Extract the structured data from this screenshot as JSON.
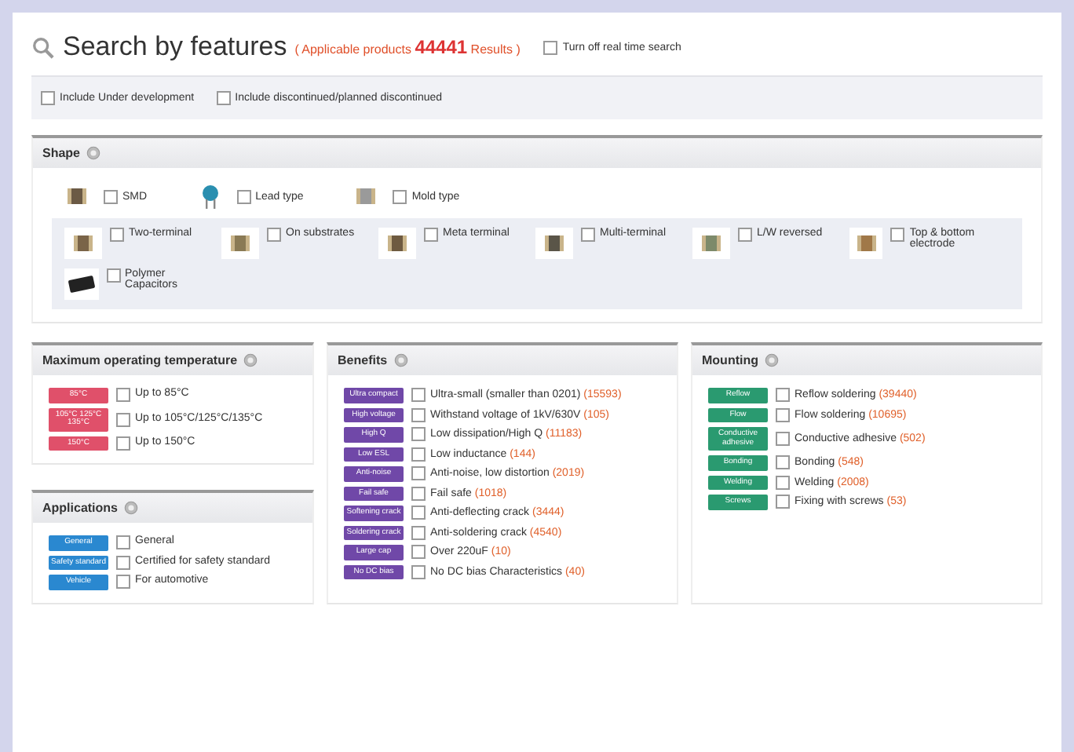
{
  "header": {
    "title": "Search by features",
    "results_prefix": "( Applicable products",
    "results_count": "44441",
    "results_suffix": "Results )",
    "realtime": {
      "label": "Turn off real time search",
      "checked": false
    }
  },
  "filters": [
    {
      "label": "Include Under development",
      "checked": false
    },
    {
      "label": "Include discontinued/planned discontinued",
      "checked": false
    }
  ],
  "shape": {
    "title": "Shape",
    "types": [
      {
        "label": "SMD",
        "checked": false
      },
      {
        "label": "Lead type",
        "checked": false
      },
      {
        "label": "Mold type",
        "checked": false
      }
    ],
    "subtypes": [
      {
        "label": "Two-terminal",
        "checked": false
      },
      {
        "label": "On substrates",
        "checked": false
      },
      {
        "label": "Meta terminal",
        "checked": false
      },
      {
        "label": "Multi-terminal",
        "checked": false
      },
      {
        "label": "L/W reversed",
        "checked": false
      },
      {
        "label": "Top & bottom electrode",
        "checked": false
      },
      {
        "label": "Polymer Capacitors",
        "checked": false
      }
    ]
  },
  "temperature": {
    "title": "Maximum operating temperature",
    "items": [
      {
        "badge": "85°C",
        "label": "Up to 85°C",
        "checked": false
      },
      {
        "badge": "105°C 125°C 135°C",
        "label": "Up to 105°C/125°C/135°C",
        "checked": false
      },
      {
        "badge": "150°C",
        "label": "Up to 150°C",
        "checked": false
      }
    ]
  },
  "applications": {
    "title": "Applications",
    "items": [
      {
        "badge": "General",
        "label": "General",
        "checked": false
      },
      {
        "badge": "Safety standard",
        "label": "Certified for safety standard",
        "checked": false
      },
      {
        "badge": "Vehicle",
        "label": "For automotive",
        "checked": false
      }
    ]
  },
  "benefits": {
    "title": "Benefits",
    "items": [
      {
        "badge": "Ultra compact",
        "label": "Ultra-small (smaller than 0201)",
        "count": "(15593)",
        "checked": false
      },
      {
        "badge": "High voltage",
        "label": "Withstand voltage of 1kV/630V",
        "count": "(105)",
        "checked": false
      },
      {
        "badge": "High Q",
        "label": "Low dissipation/High Q",
        "count": "(11183)",
        "checked": false
      },
      {
        "badge": "Low ESL",
        "label": "Low inductance",
        "count": "(144)",
        "checked": false
      },
      {
        "badge": "Anti-noise",
        "label": "Anti-noise, low distortion",
        "count": "(2019)",
        "checked": false
      },
      {
        "badge": "Fail safe",
        "label": "Fail safe",
        "count": "(1018)",
        "checked": false
      },
      {
        "badge": "Softening crack",
        "label": "Anti-deflecting crack",
        "count": "(3444)",
        "checked": false
      },
      {
        "badge": "Soldering crack",
        "label": "Anti-soldering crack",
        "count": "(4540)",
        "checked": false
      },
      {
        "badge": "Large cap",
        "label": "Over 220uF",
        "count": "(10)",
        "checked": false
      },
      {
        "badge": "No DC bias",
        "label": "No DC bias Characteristics",
        "count": "(40)",
        "checked": false
      }
    ]
  },
  "mounting": {
    "title": "Mounting",
    "items": [
      {
        "badge": "Reflow",
        "label": "Reflow soldering",
        "count": "(39440)",
        "checked": false
      },
      {
        "badge": "Flow",
        "label": "Flow soldering",
        "count": "(10695)",
        "checked": false
      },
      {
        "badge": "Conductive adhesive",
        "label": "Conductive adhesive",
        "count": "(502)",
        "checked": false
      },
      {
        "badge": "Bonding",
        "label": "Bonding",
        "count": "(548)",
        "checked": false
      },
      {
        "badge": "Welding",
        "label": "Welding",
        "count": "(2008)",
        "checked": false
      },
      {
        "badge": "Screws",
        "label": "Fixing with screws",
        "count": "(53)",
        "checked": false
      }
    ]
  }
}
